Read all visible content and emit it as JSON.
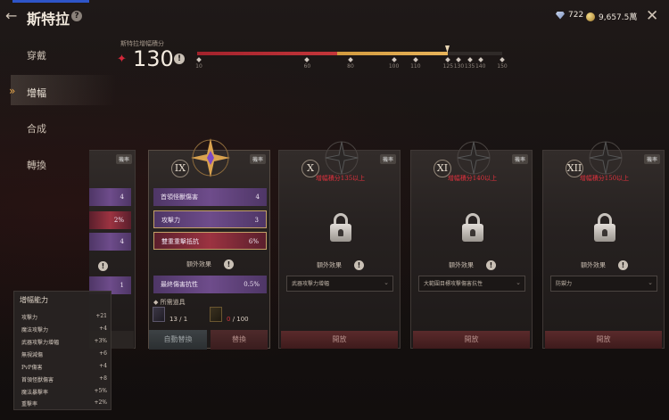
{
  "header": {
    "title": "斯特拉",
    "help_icon": "?",
    "back_icon": "←",
    "close_icon": "✕"
  },
  "currency": {
    "gems": "722",
    "gold": "9,657.5萬"
  },
  "nav": [
    {
      "label": "穿戴"
    },
    {
      "label": "增幅"
    },
    {
      "label": "合成"
    },
    {
      "label": "轉換"
    }
  ],
  "progress": {
    "label": "斯特拉增幅積分",
    "value": "130",
    "current_fraction": 0.82,
    "ticks": [
      "10",
      "60",
      "80",
      "100",
      "110",
      "125",
      "130",
      "135",
      "140",
      "150"
    ]
  },
  "cards": {
    "prev": {
      "rows": [
        "4",
        "2%",
        "4",
        "1"
      ]
    },
    "card9": {
      "rate": "機率",
      "numeral": "IX",
      "rows": [
        {
          "label": "首領怪獸傷害",
          "value": "4"
        },
        {
          "label": "攻擊力",
          "value": "3"
        },
        {
          "label": "雙重重擊抵抗",
          "value": "6%"
        }
      ],
      "extra_title": "額外效果",
      "extra_row": {
        "label": "最終傷害抗性",
        "value": "0.5%"
      },
      "items_title": "所需道具",
      "item1": "13 / 1",
      "item2_have": "0",
      "item2_need": " / 100",
      "auto_btn": "自動替換",
      "replace_btn": "替換"
    },
    "locked": [
      {
        "rate": "機率",
        "numeral": "X",
        "requirement": "增幅積分135以上",
        "extra_title": "額外效果",
        "effect": "武器攻擊力增幅",
        "button": "開放"
      },
      {
        "rate": "機率",
        "numeral": "XI",
        "requirement": "增幅積分140以上",
        "extra_title": "額外效果",
        "effect": "大範圍目標攻擊傷害抗性",
        "button": "開放"
      },
      {
        "rate": "機率",
        "numeral": "XII",
        "requirement": "增幅積分150以上",
        "extra_title": "額外效果",
        "effect": "防禦力",
        "button": "開放"
      }
    ]
  },
  "ability_panel": {
    "title": "增幅能力",
    "rows": [
      {
        "label": "攻擊力",
        "value": "+21"
      },
      {
        "label": "魔法攻擊力",
        "value": "+4"
      },
      {
        "label": "武器攻擊力增幅",
        "value": "+3%"
      },
      {
        "label": "無視減傷",
        "value": "+6"
      },
      {
        "label": "PvP傷害",
        "value": "+4"
      },
      {
        "label": "首領怪獸傷害",
        "value": "+8"
      },
      {
        "label": "魔法暴擊率",
        "value": "+5%"
      },
      {
        "label": "重擊率",
        "value": "+2%"
      }
    ]
  },
  "colors": {
    "accent_red": "#c4363a",
    "accent_gold": "#e8b45a",
    "purple_row": "#6e4c8b",
    "red_row": "#9c3341"
  }
}
